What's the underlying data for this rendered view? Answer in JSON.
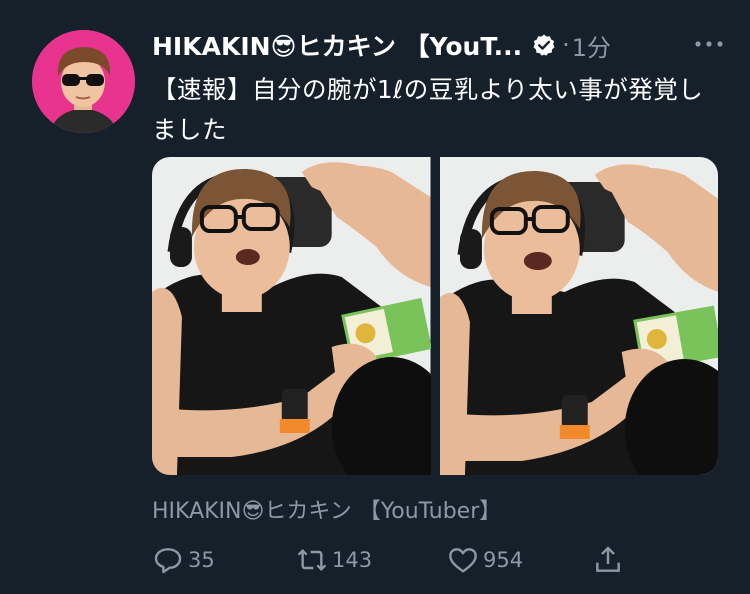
{
  "tweet": {
    "author_name": "HIKAKIN😎ヒカキン 【YouT...",
    "separator": "·",
    "time": "1分",
    "text": "【速報】自分の腕が1ℓの豆乳より太い事が発覚しました",
    "attribution": "HIKAKIN😎ヒカキン 【YouTuber】",
    "media_count": 2
  },
  "actions": {
    "replies": "35",
    "retweets": "143",
    "likes": "954"
  },
  "icons": {
    "avatar": "avatar-photo",
    "verified": "verified-badge-icon",
    "more": "more-options-icon",
    "reply": "reply-icon",
    "retweet": "retweet-icon",
    "like": "heart-icon",
    "share": "share-icon"
  },
  "colors": {
    "background": "#15202b",
    "secondary_text": "#8b98a5",
    "avatar_bg": "#e8338f"
  }
}
